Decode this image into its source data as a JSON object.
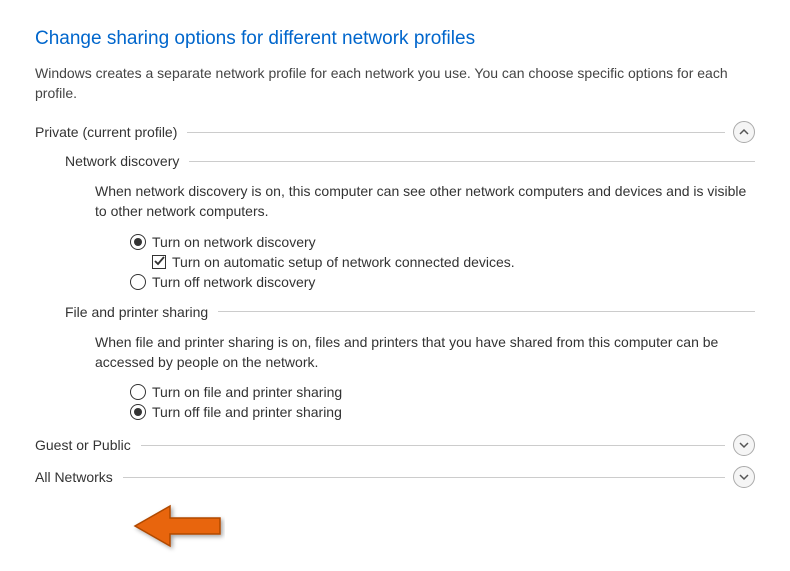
{
  "title": "Change sharing options for different network profiles",
  "description": "Windows creates a separate network profile for each network you use. You can choose specific options for each profile.",
  "sections": {
    "private": {
      "label": "Private (current profile)",
      "expanded": true,
      "network_discovery": {
        "heading": "Network discovery",
        "description": "When network discovery is on, this computer can see other network computers and devices and is visible to other network computers.",
        "options": {
          "on": "Turn on network discovery",
          "auto_setup": "Turn on automatic setup of network connected devices.",
          "off": "Turn off network discovery"
        }
      },
      "file_printer": {
        "heading": "File and printer sharing",
        "description": "When file and printer sharing is on, files and printers that you have shared from this computer can be accessed by people on the network.",
        "options": {
          "on": "Turn on file and printer sharing",
          "off": "Turn off file and printer sharing"
        }
      }
    },
    "guest": {
      "label": "Guest or Public",
      "expanded": false
    },
    "all": {
      "label": "All Networks",
      "expanded": false
    }
  }
}
